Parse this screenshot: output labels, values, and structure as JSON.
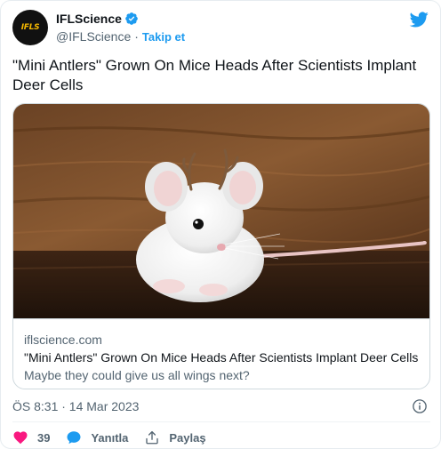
{
  "account": {
    "avatar_text": "IFLS",
    "name": "IFLScience",
    "handle": "@IFLScience",
    "separator": "·",
    "follow_label": "Takip et"
  },
  "tweet": {
    "text": "\"Mini Antlers\" Grown On Mice Heads After Scientists Implant Deer Cells"
  },
  "card": {
    "domain": "iflscience.com",
    "title": "\"Mini Antlers\" Grown On Mice Heads After Scientists Implant Deer Cells",
    "description": "Maybe they could give us all wings next?"
  },
  "meta": {
    "timestamp": "ÖS 8:31 · 14 Mar 2023"
  },
  "actions": {
    "like_count": "39",
    "reply_label": "Yanıtla",
    "share_label": "Paylaş"
  },
  "icons": {
    "verified": "verified-badge-icon",
    "twitter": "twitter-bird-icon",
    "info": "info-icon",
    "like": "heart-icon",
    "reply": "speech-bubble-icon",
    "share": "share-icon"
  },
  "colors": {
    "accent": "#1d9bf0",
    "like": "#f91880",
    "secondary_text": "#536471",
    "border": "#cfd9de",
    "avatar_text": "#f5b800"
  }
}
